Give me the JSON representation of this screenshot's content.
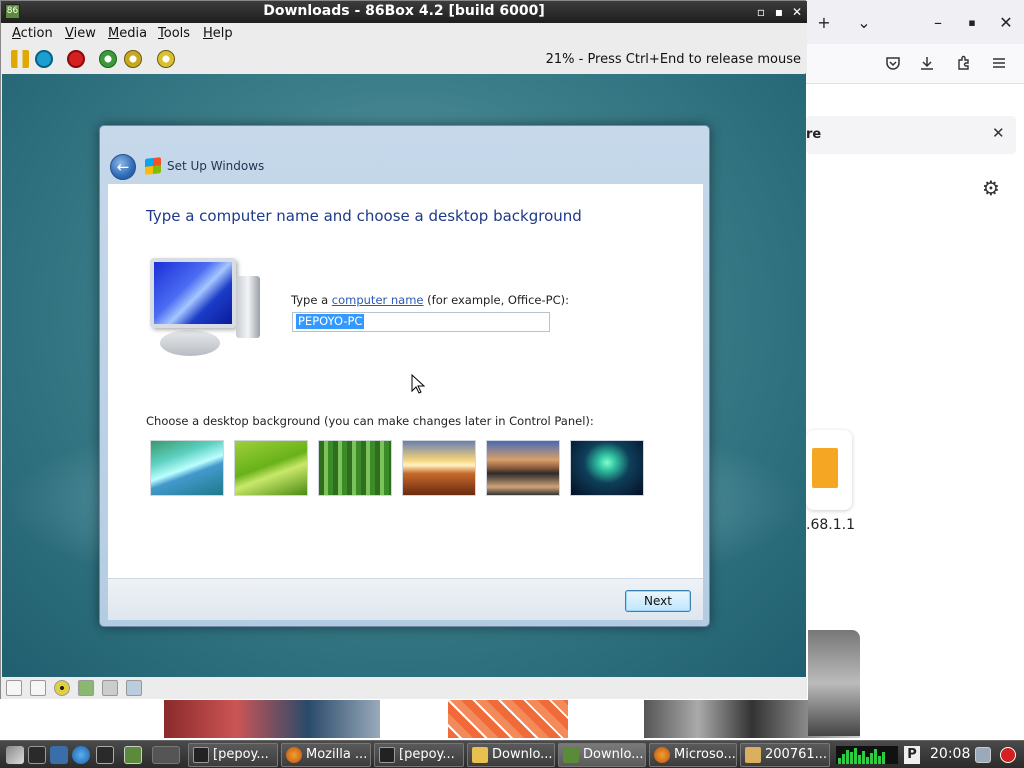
{
  "host_browser": {
    "new_tab": "+",
    "tab_list": "⌄",
    "minimize": "–",
    "maximize": "▪",
    "close": "✕",
    "notif_text": "re",
    "notif_close": "✕",
    "ip_text": ".68.1.1",
    "icons": [
      "pocket-icon",
      "download-icon",
      "extensions-icon",
      "menu-icon",
      "gear-icon"
    ]
  },
  "vm": {
    "title": "Downloads - 86Box 4.2 [build 6000]",
    "menu": [
      {
        "label": "Action",
        "underline": "A",
        "rest": "ction"
      },
      {
        "label": "View",
        "underline": "V",
        "rest": "iew"
      },
      {
        "label": "Media",
        "underline": "M",
        "rest": "edia"
      },
      {
        "label": "Tools",
        "underline": "T",
        "rest": "ools"
      },
      {
        "label": "Help",
        "underline": "H",
        "rest": "elp"
      }
    ],
    "status_text": "21% - Press Ctrl+End to release mouse",
    "colors": {
      "pause": "#e0a800",
      "reset": "#1a9fd0",
      "power": "#d42020",
      "green": "#3a9a3a"
    }
  },
  "setup": {
    "caption": "Set Up Windows",
    "heading": "Type a computer name and choose a desktop background",
    "name_label_prefix": "Type a ",
    "name_label_link": "computer name",
    "name_label_suffix": " (for example, Office-PC):",
    "name_value": "PEPOYO-PC",
    "bg_label": "Choose a desktop background (you can make changes later in Control Panel):",
    "next_label": "Next"
  },
  "taskbar": {
    "tasks": [
      {
        "label": "[pepoy...",
        "icon": "terminal-icon",
        "active": false
      },
      {
        "label": "Mozilla ...",
        "icon": "firefox-icon",
        "active": false
      },
      {
        "label": "[pepoy...",
        "icon": "terminal-icon",
        "active": false
      },
      {
        "label": "Downlo...",
        "icon": "folder-icon",
        "active": false
      },
      {
        "label": "Downlo...",
        "icon": "86box-icon",
        "active": true
      },
      {
        "label": "Microso...",
        "icon": "firefox-icon",
        "active": false
      },
      {
        "label": "200761...",
        "icon": "image-viewer-icon",
        "active": false
      }
    ],
    "p_label": "P",
    "clock": "20:08"
  }
}
